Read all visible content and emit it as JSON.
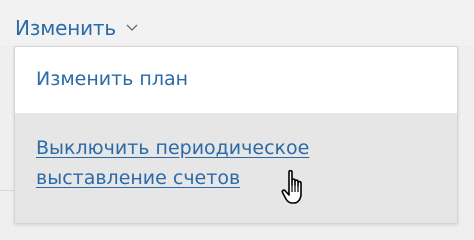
{
  "menu": {
    "trigger_label": "Изменить",
    "trigger_icon": "chevron-down-icon",
    "items": [
      {
        "label": "Изменить план"
      },
      {
        "label": "Выключить периодическое выставление счетов"
      }
    ]
  },
  "cursor_icon": "hand-pointer-icon",
  "colors": {
    "link": "#2b6aa8",
    "hover_background": "#e6e6e6",
    "menu_background": "#ffffff",
    "page_background": "#efefef"
  }
}
